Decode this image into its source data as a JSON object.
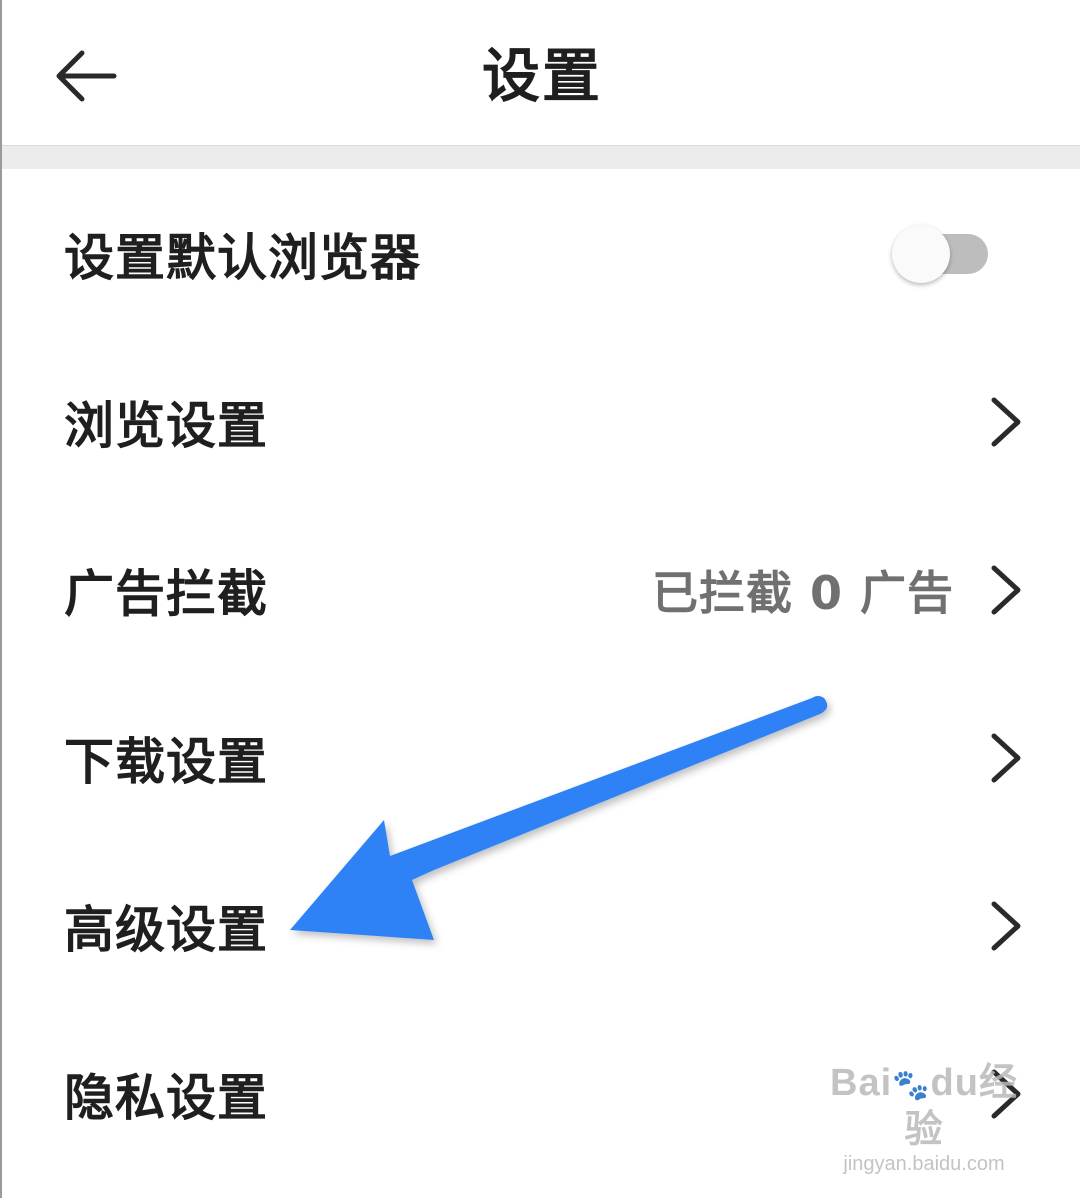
{
  "header": {
    "title": "设置",
    "back_icon": "arrow-left-icon"
  },
  "settings": {
    "default_browser": {
      "label": "设置默认浏览器",
      "toggle_on": false
    },
    "browse": {
      "label": "浏览设置"
    },
    "adblock": {
      "label": "广告拦截",
      "value": "已拦截 0 广告"
    },
    "download": {
      "label": "下载设置"
    },
    "advanced": {
      "label": "高级设置"
    },
    "privacy": {
      "label": "隐私设置"
    }
  },
  "icons": {
    "chevron": "chevron-right-icon",
    "annotation": "blue-arrow-annotation"
  },
  "colors": {
    "annotation_arrow": "#2f82f5",
    "toggle_track": "#bdbdbd",
    "divider": "#ececec"
  },
  "watermark": {
    "brand_left": "Bai",
    "brand_right": "du",
    "brand_cn": "经验",
    "url": "jingyan.baidu.com"
  }
}
